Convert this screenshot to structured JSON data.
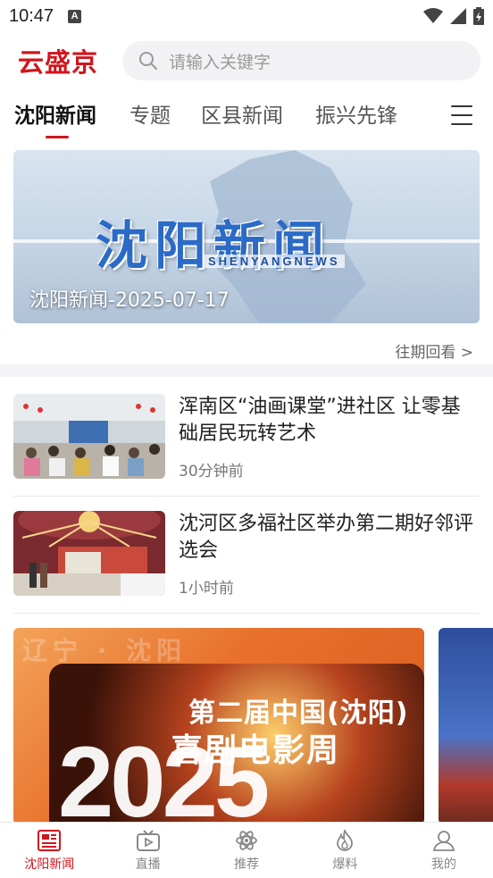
{
  "status_bar": {
    "time": "10:47",
    "notification_icon": "A"
  },
  "header": {
    "logo": "云盛京",
    "search_placeholder": "请输入关键字"
  },
  "tabs": [
    {
      "label": "沈阳新闻",
      "active": true
    },
    {
      "label": "专题",
      "active": false
    },
    {
      "label": "区县新闻",
      "active": false
    },
    {
      "label": "振兴先锋",
      "active": false
    }
  ],
  "banner": {
    "art_title": "沈阳新闻",
    "art_subtitle": "SHENYANGNEWS",
    "caption": "沈阳新闻-2025-07-17"
  },
  "history_link": "往期回看 >",
  "news": [
    {
      "headline": "浑南区“油画课堂”进社区 让零基础居民玩转艺术",
      "time": "30分钟前"
    },
    {
      "headline": "沈河区多福社区举办第二期好邻评选会",
      "time": "1小时前"
    }
  ],
  "feature_card": {
    "title_line1": "第二届中国(沈阳)",
    "title_line2": "喜剧电影周",
    "year": "2025"
  },
  "bottom_nav": [
    {
      "label": "沈阳新闻",
      "icon": "newspaper-icon",
      "active": true
    },
    {
      "label": "直播",
      "icon": "tv-play-icon",
      "active": false
    },
    {
      "label": "推荐",
      "icon": "atom-icon",
      "active": false
    },
    {
      "label": "爆料",
      "icon": "flame-icon",
      "active": false
    },
    {
      "label": "我的",
      "icon": "user-icon",
      "active": false
    }
  ],
  "colors": {
    "brand": "#d0161e",
    "search_bg": "#f2f2f4",
    "divider": "#f3f3f5"
  }
}
